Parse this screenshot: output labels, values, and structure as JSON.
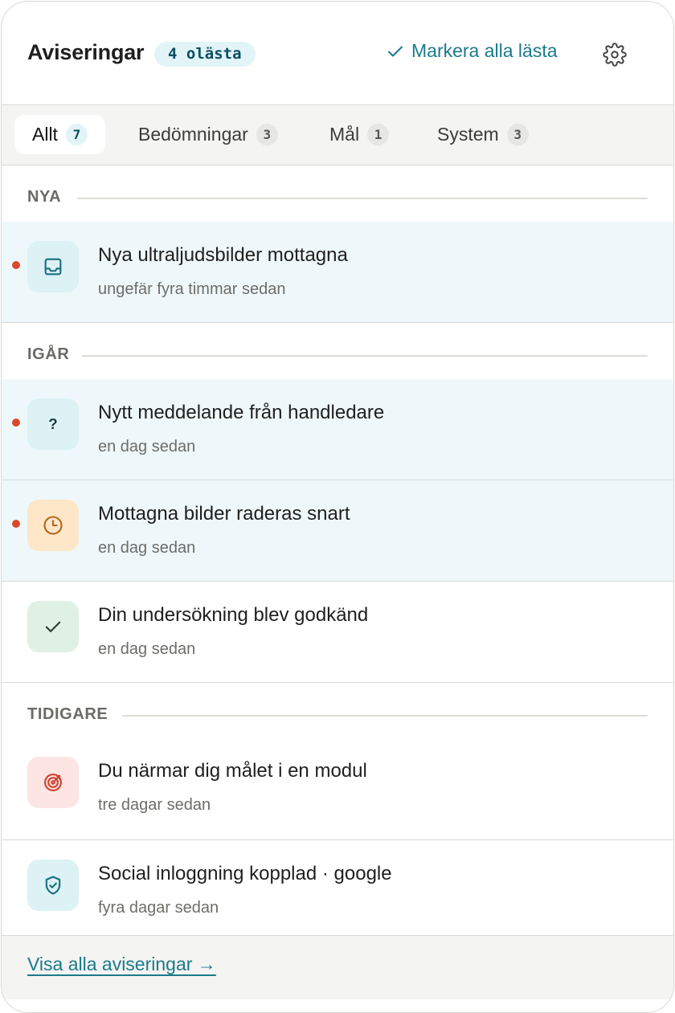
{
  "header": {
    "title": "Aviseringar",
    "unread_badge": "4 olästa",
    "mark_all_label": "Markera alla lästa"
  },
  "tabs": [
    {
      "label": "Allt",
      "count": "7",
      "active": true
    },
    {
      "label": "Bedömningar",
      "count": "3"
    },
    {
      "label": "Mål",
      "count": "1"
    },
    {
      "label": "System",
      "count": "3"
    }
  ],
  "sections": {
    "new": "NYA",
    "yesterday": "IGÅR",
    "earlier": "TIDIGARE"
  },
  "notifications": [
    {
      "title": "Nya ultraljudsbilder mottagna",
      "time": "ungefär fyra timmar sedan",
      "icon": "inbox-icon",
      "unread": true
    },
    {
      "title": "Nytt meddelande från handledare",
      "time": "en dag sedan",
      "icon": "question-icon",
      "unread": true
    },
    {
      "title": "Mottagna bilder raderas snart",
      "time": "en dag sedan",
      "icon": "clock-icon",
      "unread": true
    },
    {
      "title": "Din undersökning blev godkänd",
      "time": "en dag sedan",
      "icon": "check-icon",
      "unread": false
    },
    {
      "title": "Du närmar dig målet i en modul",
      "time": "tre dagar sedan",
      "icon": "target-icon",
      "unread": false
    },
    {
      "title": "Social inloggning kopplad · google",
      "time": "fyra dagar sedan",
      "icon": "shield-check-icon",
      "unread": false
    }
  ],
  "footer": {
    "view_all": "Visa alla aviseringar →"
  },
  "colors": {
    "accent": "#1a7a8c",
    "unread_bg": "#eef8fa",
    "unread_dot": "#d94a2b",
    "icon_teal_bg": "#dcf2f5",
    "icon_orange_bg": "#fde7c8",
    "icon_green_bg": "#dff1e4",
    "icon_red_bg": "#fde5e3"
  }
}
